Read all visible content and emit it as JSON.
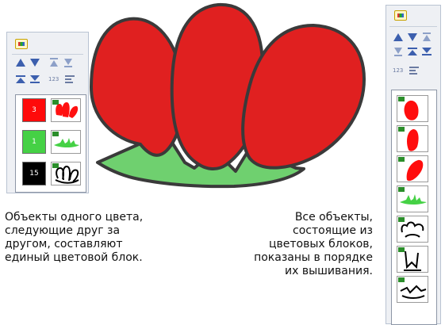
{
  "left_panel": {
    "color_blocks": [
      {
        "number": "3",
        "color": "#ff0a0a",
        "thumb": "petals-red-icon"
      },
      {
        "number": "1",
        "color": "#45d145",
        "thumb": "leaves-green-icon"
      },
      {
        "number": "15",
        "color": "#000000",
        "thumb": "outline-black-icon"
      }
    ]
  },
  "right_panel": {
    "objects": [
      {
        "thumb": "petal-left-icon",
        "color": "#ff0a0a"
      },
      {
        "thumb": "petal-middle-icon",
        "color": "#ff0a0a"
      },
      {
        "thumb": "petal-right-icon",
        "color": "#ff0a0a"
      },
      {
        "thumb": "leaves-icon",
        "color": "#45d145"
      },
      {
        "thumb": "outline-top-icon",
        "color": "#000000"
      },
      {
        "thumb": "outline-mid-icon",
        "color": "#000000"
      },
      {
        "thumb": "outline-bottom-icon",
        "color": "#000000"
      }
    ]
  },
  "captions": {
    "left": "Объекты одного цвета,\nследующие друг за\nдругом, составляют\nединый цветовой блок.",
    "right": "Все объекты,\nсостоящие из\nцветовых блоков,\nпоказаны в порядке\nих вышивания."
  },
  "colors": {
    "red": "#e02020",
    "green": "#6fd06f",
    "outline": "#3a3a3a"
  }
}
